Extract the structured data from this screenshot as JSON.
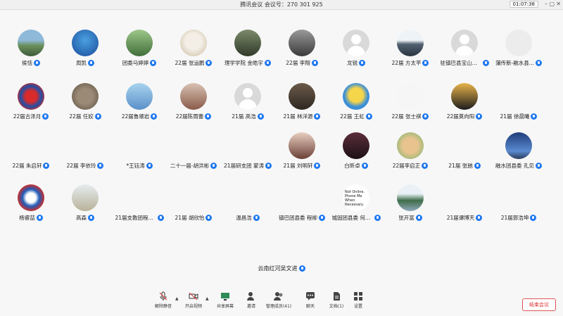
{
  "window": {
    "title": "腾讯会议  会议号：270 301 925",
    "clock": "01:07:38"
  },
  "participants": [
    {
      "name": "侯恬",
      "avatar": "landscape"
    },
    {
      "name": "周凯",
      "avatar": "sky"
    },
    {
      "name": "团委马婷婷",
      "avatar": "garden"
    },
    {
      "name": "22届 张运鹏",
      "avatar": "dog"
    },
    {
      "name": "理学学院 金皓宇",
      "avatar": "city"
    },
    {
      "name": "22届 李翔",
      "avatar": "portrait"
    },
    {
      "name": "龙锐",
      "avatar": "placeholder"
    },
    {
      "name": "22届 方太平",
      "avatar": "mountain"
    },
    {
      "name": "驻镇巴县宝山村...",
      "avatar": "placeholder"
    },
    {
      "name": "蒲传新-融水县...",
      "avatar": "sketch"
    },
    {
      "name": "22届古泽月",
      "avatar": "shield"
    },
    {
      "name": "22届 任姣",
      "avatar": "otter"
    },
    {
      "name": "22届鲁顺岩",
      "avatar": "beach"
    },
    {
      "name": "22届陈雨蕾",
      "avatar": "room"
    },
    {
      "name": "21届 高浩",
      "avatar": "placeholder"
    },
    {
      "name": "21届 林洋源",
      "avatar": "photo"
    },
    {
      "name": "22届 王虹",
      "avatar": "cartoon"
    },
    {
      "name": "22届 张士祺",
      "avatar": "figure"
    },
    {
      "name": "22届莫向阳",
      "avatar": "sunset"
    },
    {
      "name": "21届 徐晨曦",
      "avatar": "none"
    },
    {
      "name": "22届 朱启轩",
      "avatar": "none"
    },
    {
      "name": "22届 李依玲",
      "avatar": "none"
    },
    {
      "name": "*王钰涛",
      "avatar": "none"
    },
    {
      "name": "二十一届-胡洪彬",
      "avatar": "none"
    },
    {
      "name": "21届研支团 蒙涛",
      "avatar": "none"
    },
    {
      "name": "21届 刘明轩",
      "avatar": "girl"
    },
    {
      "name": "白昕卓",
      "avatar": "woman"
    },
    {
      "name": "22届李启正",
      "avatar": "drawing"
    },
    {
      "name": "21届 张驰",
      "avatar": "none"
    },
    {
      "name": "融水团县委 孔见",
      "avatar": "night"
    },
    {
      "name": "杨睿喆",
      "avatar": "logo"
    },
    {
      "name": "高森",
      "avatar": "bridge"
    },
    {
      "name": "21届支教团程凯...",
      "avatar": "none"
    },
    {
      "name": "21届 胡欣怡",
      "avatar": "none"
    },
    {
      "name": "温昌浩",
      "avatar": "none"
    },
    {
      "name": "镇巴团县委 程柳",
      "avatar": "none"
    },
    {
      "name": "城固团县委 何依...",
      "avatar": "text",
      "avatar_text": "Not Online. Phone Me When Necessary."
    },
    {
      "name": "张开富",
      "avatar": "lake"
    },
    {
      "name": "21届谭博天",
      "avatar": "none"
    },
    {
      "name": "21届郭浩坤",
      "avatar": "none"
    }
  ],
  "active_speaker": "云南红河吴文进",
  "toolbar": {
    "unmute": "解除静音",
    "video": "开启视频",
    "share": "共享屏幕",
    "invite": "邀请",
    "members": "管理成员(41)",
    "chat": "聊天",
    "docs": "文档(1)",
    "settings": "设置",
    "end": "结束会议"
  },
  "colors": {
    "accent": "#1e78f0",
    "danger": "#e03030"
  }
}
